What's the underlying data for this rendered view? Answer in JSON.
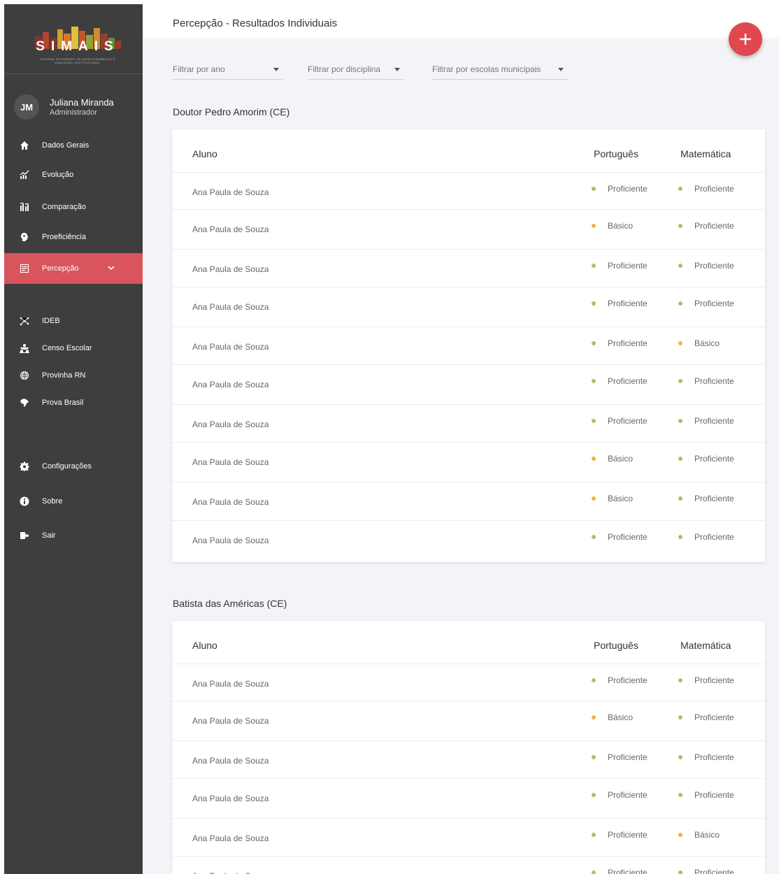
{
  "logo": {
    "text": "SIMAIS",
    "subtitle": "SISTEMA INTEGRADO DE MONITORAMENTO E AVALIAÇÃO INSTITUCIONAL"
  },
  "user": {
    "initials": "JM",
    "name": "Juliana Miranda",
    "role": "Administrador"
  },
  "nav": {
    "dados_gerais": "Dados Gerais",
    "evolucao": "Evolução",
    "comparacao": "Comparação",
    "proficiencia": "Proeficiência",
    "percepcao": "Percepção",
    "ideb": "IDEB",
    "censo": "Censo Escolar",
    "provinha": "Provinha RN",
    "prova_brasil": "Prova Brasil",
    "config": "Configurações",
    "sobre": "Sobre",
    "sair": "Sair"
  },
  "header": {
    "title": "Percepção - Resultados Individuais"
  },
  "filters": {
    "ano": "Filtrar por ano",
    "disciplina": "Filtrar por disciplina",
    "escolas": "Filtrar por escolas municipais"
  },
  "colors": {
    "sidebar": "#3e3e3e",
    "accent": "#d9545c",
    "fab": "#e0474f",
    "proficiente": "#a9c26b",
    "basico": "#f2b33d"
  },
  "tables": [
    {
      "school": "Doutor Pedro Amorim (CE)",
      "headers": {
        "aluno": "Aluno",
        "portugues": "Português",
        "matematica": "Matemática"
      },
      "rows": [
        {
          "name": "Ana Paula de Souza",
          "pt": "Proficiente",
          "mt": "Proficiente"
        },
        {
          "name": "Ana Paula de Souza",
          "pt": "Básico",
          "mt": "Proficiente"
        },
        {
          "name": "Ana Paula de Souza",
          "pt": "Proficiente",
          "mt": "Proficiente"
        },
        {
          "name": "Ana Paula de Souza",
          "pt": "Proficiente",
          "mt": "Proficiente"
        },
        {
          "name": "Ana Paula de Souza",
          "pt": "Proficiente",
          "mt": "Básico"
        },
        {
          "name": "Ana Paula de Souza",
          "pt": "Proficiente",
          "mt": "Proficiente"
        },
        {
          "name": "Ana Paula de Souza",
          "pt": "Proficiente",
          "mt": "Proficiente"
        },
        {
          "name": "Ana Paula de Souza",
          "pt": "Básico",
          "mt": "Proficiente"
        },
        {
          "name": "Ana Paula de Souza",
          "pt": "Básico",
          "mt": "Proficiente"
        },
        {
          "name": "Ana Paula de Souza",
          "pt": "Proficiente",
          "mt": "Proficiente"
        }
      ]
    },
    {
      "school": "Batista das Américas (CE)",
      "headers": {
        "aluno": "Aluno",
        "portugues": "Português",
        "matematica": "Matemática"
      },
      "rows": [
        {
          "name": "Ana Paula de Souza",
          "pt": "Proficiente",
          "mt": "Proficiente"
        },
        {
          "name": "Ana Paula de Souza",
          "pt": "Básico",
          "mt": "Proficiente"
        },
        {
          "name": "Ana Paula de Souza",
          "pt": "Proficiente",
          "mt": "Proficiente"
        },
        {
          "name": "Ana Paula de Souza",
          "pt": "Proficiente",
          "mt": "Proficiente"
        },
        {
          "name": "Ana Paula de Souza",
          "pt": "Proficiente",
          "mt": "Básico"
        },
        {
          "name": "Ana Paula de Souza",
          "pt": "Proficiente",
          "mt": "Proficiente"
        }
      ]
    }
  ]
}
